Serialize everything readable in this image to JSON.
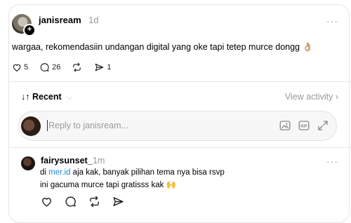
{
  "post": {
    "username": "janisream",
    "time": "1d",
    "more": "···",
    "text": "wargaa, rekomendasiin undangan digital yang oke tapi tetep murce dongg 👌🏼",
    "likes": "5",
    "comments": "26",
    "shares": "1",
    "avatar_badge": "+"
  },
  "sort": {
    "arrow": "↓↑",
    "label": "Recent",
    "view_activity": "View activity ›"
  },
  "reply": {
    "placeholder": "Reply to janisream..."
  },
  "comment": {
    "username": "fairysunset_",
    "time": "1m",
    "more": "···",
    "line1_pre": "di ",
    "line1_link": "mer.id",
    "line1_post": " aja kak, banyak pilihan tema nya bisa rsvp",
    "line2": "ini gacuma murce tapi gratisss kak 🙌"
  },
  "icons": {
    "like": "heart-icon",
    "comment": "comment-icon",
    "repost": "repost-icon",
    "share": "share-icon",
    "image": "image-icon",
    "gif": "gif-icon",
    "expand": "expand-icon"
  }
}
